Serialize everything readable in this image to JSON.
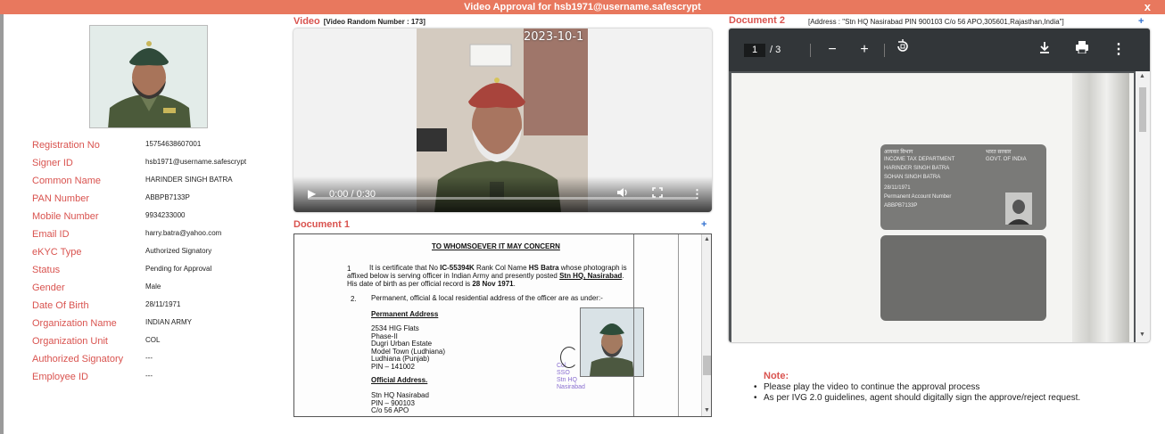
{
  "window": {
    "title": "Video Approval for hsb1971@username.safescrypt",
    "close_label": "x"
  },
  "profile": {
    "fields": [
      {
        "label": "Registration No",
        "value": "15754638607001"
      },
      {
        "label": "Signer ID",
        "value": "hsb1971@username.safescrypt"
      },
      {
        "label": "Common Name",
        "value": "HARINDER SINGH BATRA"
      },
      {
        "label": "PAN Number",
        "value": "ABBPB7133P"
      },
      {
        "label": "Mobile Number",
        "value": "9934233000"
      },
      {
        "label": "Email ID",
        "value": "harry.batra@yahoo.com"
      },
      {
        "label": "eKYC Type",
        "value": "Authorized Signatory"
      },
      {
        "label": "Status",
        "value": "Pending for Approval"
      },
      {
        "label": "Gender",
        "value": "Male"
      },
      {
        "label": "Date Of Birth",
        "value": "28/11/1971"
      },
      {
        "label": "Organization Name",
        "value": "INDIAN ARMY"
      },
      {
        "label": "Organization Unit",
        "value": "COL"
      },
      {
        "label": "Authorized Signatory",
        "value": "---"
      },
      {
        "label": "Employee ID",
        "value": "---"
      }
    ]
  },
  "video": {
    "heading": "Video",
    "random_number": "[Video Random Number : 173]",
    "timestamp_overlay": "2023-10-1",
    "time": "0:00 / 0:30",
    "progress": 0
  },
  "document1": {
    "heading": "Document 1",
    "expand_label": "+",
    "content": {
      "title": "TO WHOMSOEVER IT MAY CONCERN",
      "para1_num": "1",
      "para1_a": "It is certificate that No ",
      "para1_b": "IC-55394K",
      "para1_c": " Rank Col Name ",
      "para1_d": "HS Batra",
      "para1_e": " whose photograph is",
      "para1_line2a": "affixed below is serving officer in Indian Army and presently posted ",
      "para1_line2b": "Stn HQ, Nasirabad",
      "para1_line2c": ".",
      "para1_line3a": "His date of birth as per official record is ",
      "para1_line3b": "28 Nov 1971",
      "para1_line3c": ".",
      "para2_num": "2.",
      "para2": "Permanent, official & local residential address of the officer are as under:-",
      "perm_heading": "Permanent Address",
      "perm_lines": [
        "2534 HIG Flats",
        "Phase-II",
        "Dugri Urban Estate",
        "Model Town (Ludhiana)",
        "Ludhiana (Punjab)",
        "PIN – 141002"
      ],
      "official_heading": "Official Address.",
      "official_lines": [
        "Stn HQ Nasirabad",
        "PIN – 900103",
        "C/o 56 APO"
      ],
      "stamp_lines": [
        "Col",
        "SSO",
        "Stn HQ",
        "Nasirabad"
      ]
    }
  },
  "document2": {
    "heading": "Document 2",
    "address": "[Address : \"Stn HQ Nasirabad PIN 900103 C/o 56 APO,305601,Rajasthan,India\"]",
    "expand_label": "+",
    "page_current": "1",
    "page_total": "/  3",
    "card_lines": [
      "आयकर विभाग",
      "INCOME TAX DEPARTMENT",
      "भारत सरकार",
      "GOVT. OF INDIA",
      "HARINDER SINGH BATRA",
      "SOHAN SINGH BATRA",
      "28/11/1971",
      "Permanent Account Number",
      "ABBPB7133P"
    ]
  },
  "note": {
    "title": "Note:",
    "items": [
      "Please play the video to continue the approval process",
      "As per IVG 2.0 guidelines, agent should digitally sign the approve/reject request."
    ]
  },
  "colors": {
    "title_bar": "#e8785e",
    "label": "#d9534f",
    "link": "#2f6fd0",
    "pdf_toolbar": "#323639"
  }
}
